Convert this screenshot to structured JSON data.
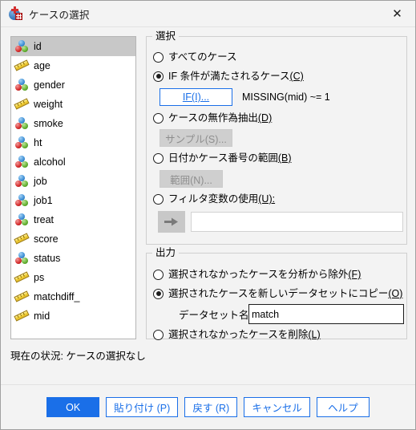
{
  "window": {
    "title": "ケースの選択",
    "icon": "spss-app-icon",
    "close_label": "✕"
  },
  "variable_list": {
    "items": [
      {
        "name": "id",
        "measure": "nominal",
        "selected": true
      },
      {
        "name": "age",
        "measure": "scale",
        "selected": false
      },
      {
        "name": "gender",
        "measure": "nominal",
        "selected": false
      },
      {
        "name": "weight",
        "measure": "scale",
        "selected": false
      },
      {
        "name": "smoke",
        "measure": "nominal",
        "selected": false
      },
      {
        "name": "ht",
        "measure": "nominal",
        "selected": false
      },
      {
        "name": "alcohol",
        "measure": "nominal",
        "selected": false
      },
      {
        "name": "job",
        "measure": "nominal",
        "selected": false
      },
      {
        "name": "job1",
        "measure": "nominal",
        "selected": false
      },
      {
        "name": "treat",
        "measure": "nominal",
        "selected": false
      },
      {
        "name": "score",
        "measure": "scale",
        "selected": false
      },
      {
        "name": "status",
        "measure": "nominal",
        "selected": false
      },
      {
        "name": "ps",
        "measure": "scale",
        "selected": false
      },
      {
        "name": "matchdiff_",
        "measure": "scale",
        "selected": false
      },
      {
        "name": "mid",
        "measure": "scale",
        "selected": false
      }
    ]
  },
  "selection_group": {
    "title": "選択",
    "all_cases": {
      "label": "すべてのケース",
      "checked": false
    },
    "if_condition": {
      "label_text": "IF 条件が満たされるケース",
      "mnemonic": "(C)",
      "checked": true
    },
    "if_button": {
      "label": "IF(I)...",
      "enabled": true
    },
    "if_expression": "MISSING(mid) ~= 1",
    "random_sample": {
      "label_text": "ケースの無作為抽出",
      "mnemonic": "(D)",
      "checked": false
    },
    "sample_button": {
      "label": "サンプル(S)...",
      "enabled": false
    },
    "range": {
      "label_text": "日付かケース番号の範囲",
      "mnemonic": "(B)",
      "checked": false
    },
    "range_button": {
      "label": "範囲(N)...",
      "enabled": false
    },
    "filter_variable": {
      "label_text": "フィルタ変数の使用",
      "mnemonic": "(U):",
      "checked": false
    },
    "filter_arrow_icon": "arrow-right-icon",
    "filter_field_value": ""
  },
  "output_group": {
    "title": "出力",
    "filter_out": {
      "label_text": "選択されなかったケースを分析から除外",
      "mnemonic": "(F)",
      "checked": false
    },
    "copy_to_new": {
      "label_text": "選択されたケースを新しいデータセットにコピー",
      "mnemonic": "(O)",
      "checked": true
    },
    "dataset_name_label": "データセット名(S):",
    "dataset_name_value": "match",
    "delete_unselected": {
      "label_text": "選択されなかったケースを削除",
      "mnemonic": "(L)",
      "checked": false
    }
  },
  "status": {
    "text": "現在の状況: ケースの選択なし"
  },
  "footer": {
    "buttons": [
      {
        "label": "OK",
        "primary": true
      },
      {
        "label": "貼り付け (P)",
        "primary": false
      },
      {
        "label": "戻す (R)",
        "primary": false
      },
      {
        "label": "キャンセル",
        "primary": false
      },
      {
        "label": "ヘルプ",
        "primary": false
      }
    ]
  },
  "colors": {
    "accent": "#1a6fe8",
    "dialog_bg": "#f3f3f3",
    "selection_bg": "#c8c8c8",
    "disabled_bg": "#cfcfcf"
  }
}
